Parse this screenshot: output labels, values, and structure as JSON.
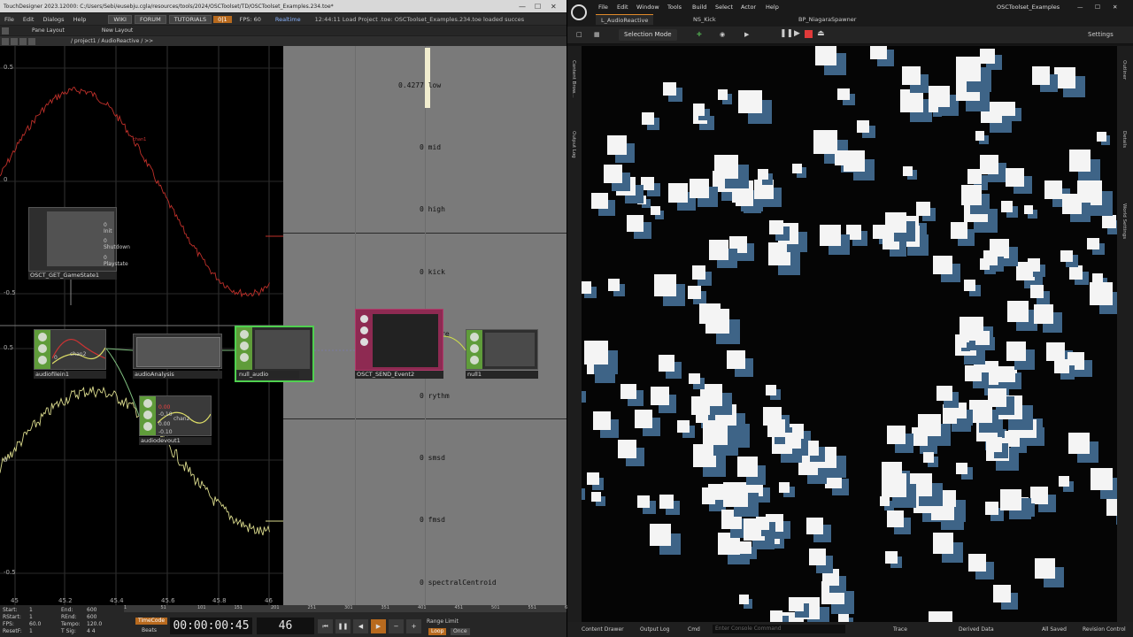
{
  "td": {
    "title": "TouchDesigner 2023.12000: C:/Users/Sebi/eusebju.cgla/resources/tools/2024/OSCToolset/TD/OSCToolset_Examples.234.toe*",
    "menu": [
      "File",
      "Edit",
      "Dialogs",
      "Help"
    ],
    "top_buttons": {
      "wiki": "WIKI",
      "forum": "FORUM",
      "tutorials": "TUTORIALS",
      "perf": "0|1",
      "fps": "FPS: 60",
      "realtime": "Realtime"
    },
    "status_log": "12:44:11 Load Project .toe: OSCToolset_Examples.234.toe loaded succes",
    "pane_layout": "Pane Layout",
    "new_layout": "New Layout",
    "path": "/ project1 / AudioReactive / >>",
    "chart_yticks": [
      "0.5",
      "0",
      "-0.5",
      "0.5",
      "0",
      "-0.5"
    ],
    "chart_xticks": [
      "45",
      "45.2",
      "45.4",
      "45.6",
      "45.8",
      "46"
    ],
    "chart_chan_label": "chan1",
    "nodes": {
      "gamestate": {
        "label": "OSCT_GET_GameState1",
        "lines": [
          "0 Init",
          "0 Shutdown",
          "0 Playstate"
        ]
      },
      "audiofilein": {
        "label": "audiofilein1",
        "lines": [
          "chan1",
          "chan2",
          "0",
          "-0.5"
        ]
      },
      "audioanalysis": {
        "label": "audioAnalysis"
      },
      "nullaudio": {
        "label": "null_audio"
      },
      "audiodevout": {
        "label": "audiodevout1",
        "lines": [
          "0.00",
          "-0.10",
          "0.00",
          "-0.10"
        ],
        "title": "chan2"
      },
      "send": {
        "label": "OSCT_SEND_Event2"
      },
      "null1": {
        "label": "null1"
      }
    },
    "data_rows": [
      {
        "value": "0.4277",
        "name": "low"
      },
      {
        "value": "0",
        "name": "mid"
      },
      {
        "value": "0",
        "name": "high"
      },
      {
        "value": "0",
        "name": "kick"
      },
      {
        "value": "0",
        "name": "snare"
      },
      {
        "value": "0",
        "name": "rythm"
      },
      {
        "value": "0",
        "name": "smsd"
      },
      {
        "value": "0",
        "name": "fmsd"
      },
      {
        "value": "0",
        "name": "spectralCentroid"
      }
    ],
    "low_level": 0.4277,
    "bottom": {
      "start": "Start:",
      "start_v": "1",
      "rstart": "RStart:",
      "rstart_v": "1",
      "fps": "FPS:",
      "fps_v": "60.0",
      "resetf": "ResetF:",
      "resetf_v": "1",
      "end": "End:",
      "end_v": "600",
      "rend": "REnd:",
      "rend_v": "600",
      "tempo": "Tempo:",
      "tempo_v": "120.0",
      "tsig": "T Sig:",
      "tsig_v": "4   4",
      "timecode_label": "TimeCode",
      "beats_label": "Beats",
      "timecode": "00:00:00:45",
      "frame": "46",
      "range_limit": "Range Limit",
      "loop": "Loop",
      "once": "Once",
      "ruler": [
        "1",
        "51",
        "101",
        "151",
        "201",
        "251",
        "301",
        "351",
        "401",
        "451",
        "501",
        "551",
        "600"
      ]
    }
  },
  "ue": {
    "menu": [
      "File",
      "Edit",
      "Window",
      "Tools",
      "Build",
      "Select",
      "Actor",
      "Help"
    ],
    "project": "OSCToolset_Examples",
    "tabs": [
      "L_AudioReactive",
      "NS_Kick",
      "BP_NiagaraSpawner"
    ],
    "selection_mode": "Selection Mode",
    "settings": "Settings",
    "left_panel": [
      "Content Brow...",
      "Output Log"
    ],
    "right_panel": [
      "Outliner",
      "Details",
      "World Settings"
    ],
    "status": {
      "content_drawer": "Content Drawer",
      "output_log": "Output Log",
      "cmd": "Cmd",
      "console_ph": "Enter Console Command",
      "trace": "Trace",
      "derived": "Derived Data",
      "saved": "All Saved",
      "revision": "Revision Control"
    }
  }
}
